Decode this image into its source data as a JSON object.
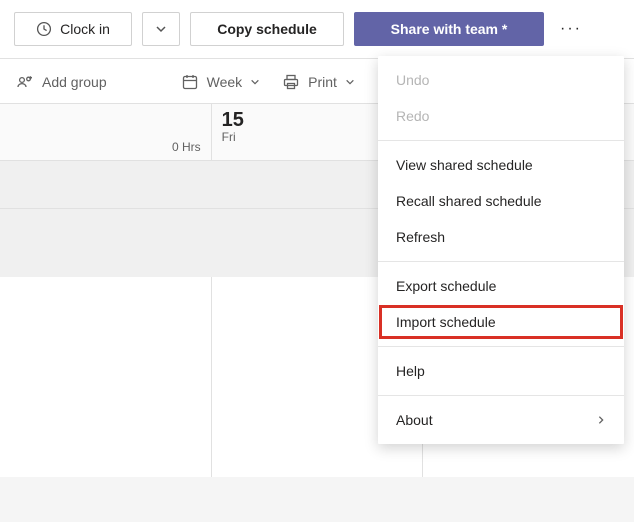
{
  "toolbar": {
    "clock_in": "Clock in",
    "copy_schedule": "Copy schedule",
    "share_with_team": "Share with team *"
  },
  "subtoolbar": {
    "add_group": "Add group",
    "week": "Week",
    "print": "Print"
  },
  "calendar": {
    "hrs_label": "0 Hrs",
    "day_number": "15",
    "day_name": "Fri"
  },
  "menu": {
    "undo": "Undo",
    "redo": "Redo",
    "view_shared": "View shared schedule",
    "recall_shared": "Recall shared schedule",
    "refresh": "Refresh",
    "export_schedule": "Export schedule",
    "import_schedule": "Import schedule",
    "help": "Help",
    "about": "About"
  }
}
